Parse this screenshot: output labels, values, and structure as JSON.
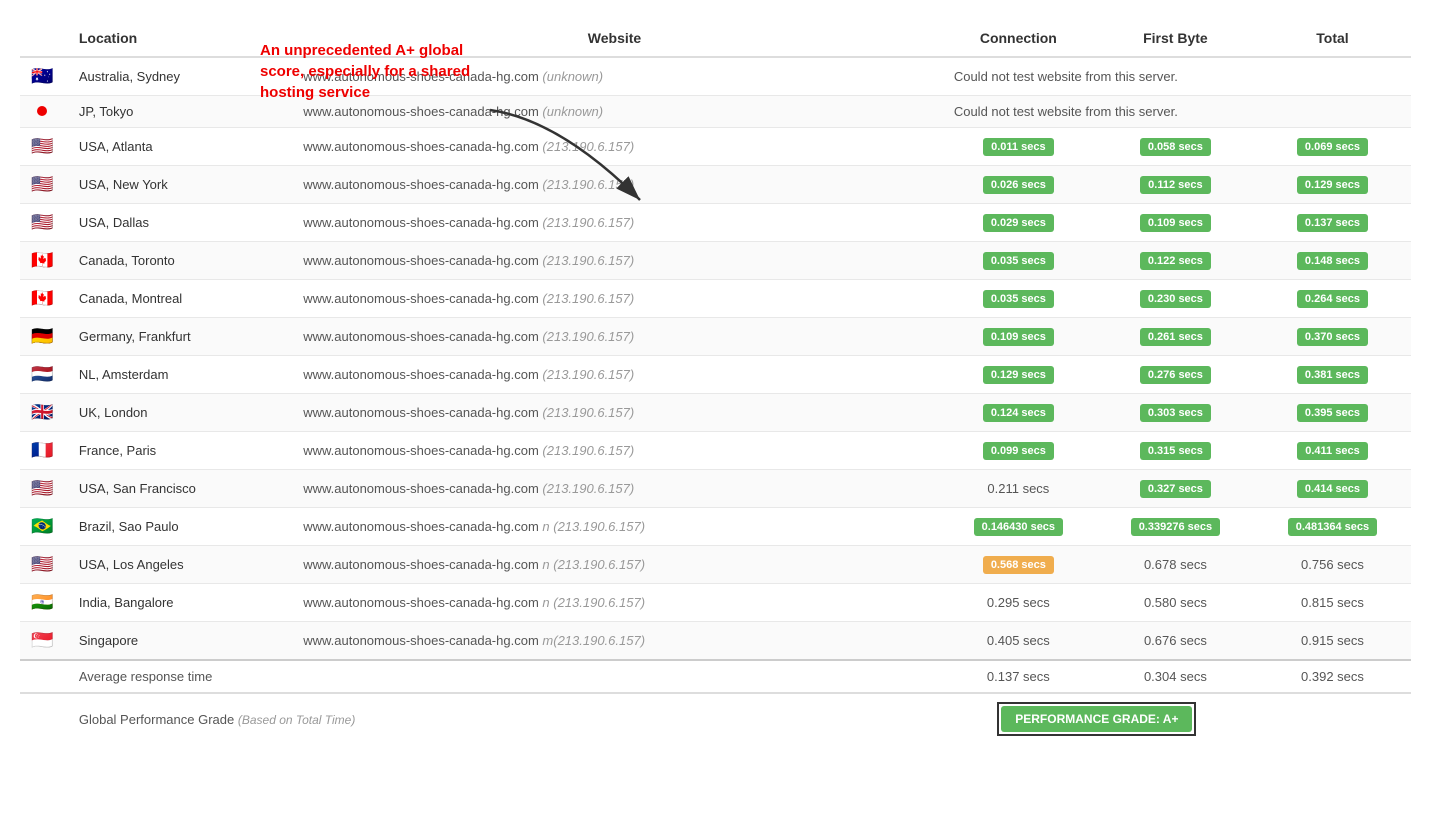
{
  "table": {
    "headers": [
      "",
      "Location",
      "Website",
      "Connection",
      "First Byte",
      "Total"
    ],
    "rows": [
      {
        "flag": "🇦🇺",
        "location": "Australia, Sydney",
        "website": "www.autonomous-shoes-canada-hg.com",
        "ip": "(unknown)",
        "connection": null,
        "connection_plain": "Could not test website from this server.",
        "first_byte": null,
        "total": null,
        "error": true
      },
      {
        "flag": "🔴",
        "location": "JP, Tokyo",
        "website": "www.autonomous-shoes-canada-hg.com",
        "ip": "(unknown)",
        "connection": null,
        "connection_plain": "Could not test website from this server.",
        "first_byte": null,
        "total": null,
        "error": true,
        "is_dot": true
      },
      {
        "flag": "🇺🇸",
        "location": "USA, Atlanta",
        "website": "www.autonomous-shoes-canada-hg.com",
        "ip": "(213.190.6.157)",
        "connection": "0.011 secs",
        "connection_color": "green",
        "first_byte": "0.058 secs",
        "first_byte_color": "green",
        "total": "0.069 secs",
        "total_color": "green"
      },
      {
        "flag": "🇺🇸",
        "location": "USA, New York",
        "website": "www.autonomous-shoes-canada-hg.com",
        "ip": "(213.190.6.157)",
        "connection": "0.026 secs",
        "connection_color": "green",
        "first_byte": "0.112 secs",
        "first_byte_color": "green",
        "total": "0.129 secs",
        "total_color": "green"
      },
      {
        "flag": "🇺🇸",
        "location": "USA, Dallas",
        "website": "www.autonomous-shoes-canada-hg.com",
        "ip": "(213.190.6.157)",
        "connection": "0.029 secs",
        "connection_color": "green",
        "first_byte": "0.109 secs",
        "first_byte_color": "green",
        "total": "0.137 secs",
        "total_color": "green"
      },
      {
        "flag": "🇨🇦",
        "location": "Canada, Toronto",
        "website": "www.autonomous-shoes-canada-hg.com",
        "ip": "(213.190.6.157)",
        "connection": "0.035 secs",
        "connection_color": "green",
        "first_byte": "0.122 secs",
        "first_byte_color": "green",
        "total": "0.148 secs",
        "total_color": "green"
      },
      {
        "flag": "🇨🇦",
        "location": "Canada, Montreal",
        "website": "www.autonomous-shoes-canada-hg.com",
        "ip": "(213.190.6.157)",
        "connection": "0.035 secs",
        "connection_color": "green",
        "first_byte": "0.230 secs",
        "first_byte_color": "green",
        "total": "0.264 secs",
        "total_color": "green"
      },
      {
        "flag": "🇩🇪",
        "location": "Germany, Frankfurt",
        "website": "www.autonomous-shoes-canada-hg.com",
        "ip": "(213.190.6.157)",
        "connection": "0.109 secs",
        "connection_color": "green",
        "first_byte": "0.261 secs",
        "first_byte_color": "green",
        "total": "0.370 secs",
        "total_color": "green"
      },
      {
        "flag": "🇳🇱",
        "location": "NL, Amsterdam",
        "website": "www.autonomous-shoes-canada-hg.com",
        "ip": "(213.190.6.157)",
        "connection": "0.129 secs",
        "connection_color": "green",
        "first_byte": "0.276 secs",
        "first_byte_color": "green",
        "total": "0.381 secs",
        "total_color": "green"
      },
      {
        "flag": "🇬🇧",
        "location": "UK, London",
        "website": "www.autonomous-shoes-canada-hg.com",
        "ip": "(213.190.6.157)",
        "connection": "0.124 secs",
        "connection_color": "green",
        "first_byte": "0.303 secs",
        "first_byte_color": "green",
        "total": "0.395 secs",
        "total_color": "green"
      },
      {
        "flag": "🇫🇷",
        "location": "France, Paris",
        "website": "www.autonomous-shoes-canada-hg.com",
        "ip": "(213.190.6.157)",
        "connection": "0.099 secs",
        "connection_color": "green",
        "first_byte": "0.315 secs",
        "first_byte_color": "green",
        "total": "0.411 secs",
        "total_color": "green"
      },
      {
        "flag": "🇺🇸",
        "location": "USA, San Francisco",
        "website": "www.autonomous-shoes-canada-hg.com",
        "ip": "(213.190.6.157)",
        "connection": "0.211 secs",
        "connection_color": "plain",
        "first_byte": "0.327 secs",
        "first_byte_color": "green",
        "total": "0.414 secs",
        "total_color": "green"
      },
      {
        "flag": "🇧🇷",
        "location": "Brazil, Sao Paulo",
        "website": "www.autonomous-shoes-canada-hg.com",
        "ip": "n (213.190.6.157)",
        "connection": "0.146430 secs",
        "connection_color": "green",
        "first_byte": "0.339276 secs",
        "first_byte_color": "green",
        "total": "0.481364 secs",
        "total_color": "green"
      },
      {
        "flag": "🇺🇸",
        "location": "USA, Los Angeles",
        "website": "www.autonomous-shoes-canada-hg.com",
        "ip": "n (213.190.6.157)",
        "connection": "0.568 secs",
        "connection_color": "orange",
        "first_byte": "0.678 secs",
        "first_byte_color": "plain",
        "total": "0.756 secs",
        "total_color": "plain"
      },
      {
        "flag": "🇮🇳",
        "location": "India, Bangalore",
        "website": "www.autonomous-shoes-canada-hg.com",
        "ip": "n (213.190.6.157)",
        "connection": "0.295 secs",
        "connection_color": "plain",
        "first_byte": "0.580 secs",
        "first_byte_color": "plain",
        "total": "0.815 secs",
        "total_color": "plain"
      },
      {
        "flag": "🇸🇬",
        "location": "Singapore",
        "website": "www.autonomous-shoes-canada-hg.com",
        "ip": "m (213.190.6.157)",
        "connection": "0.405 secs",
        "connection_color": "plain",
        "first_byte": "0.676 secs",
        "first_byte_color": "plain",
        "total": "0.915 secs",
        "total_color": "plain"
      }
    ],
    "footer": {
      "avg_label": "Average response time",
      "avg_connection": "0.137 secs",
      "avg_first_byte": "0.304 secs",
      "avg_total": "0.392 secs",
      "grade_label": "Global Performance Grade",
      "grade_subtitle": "(Based on Total Time)",
      "grade_badge": "PERFORMANCE GRADE: A+"
    }
  },
  "callout": {
    "text": "An unprecedented A+ global score, especially for a shared hosting service"
  },
  "colors": {
    "green": "#5cb85c",
    "orange": "#f0ad4e",
    "red": "#e00000"
  }
}
